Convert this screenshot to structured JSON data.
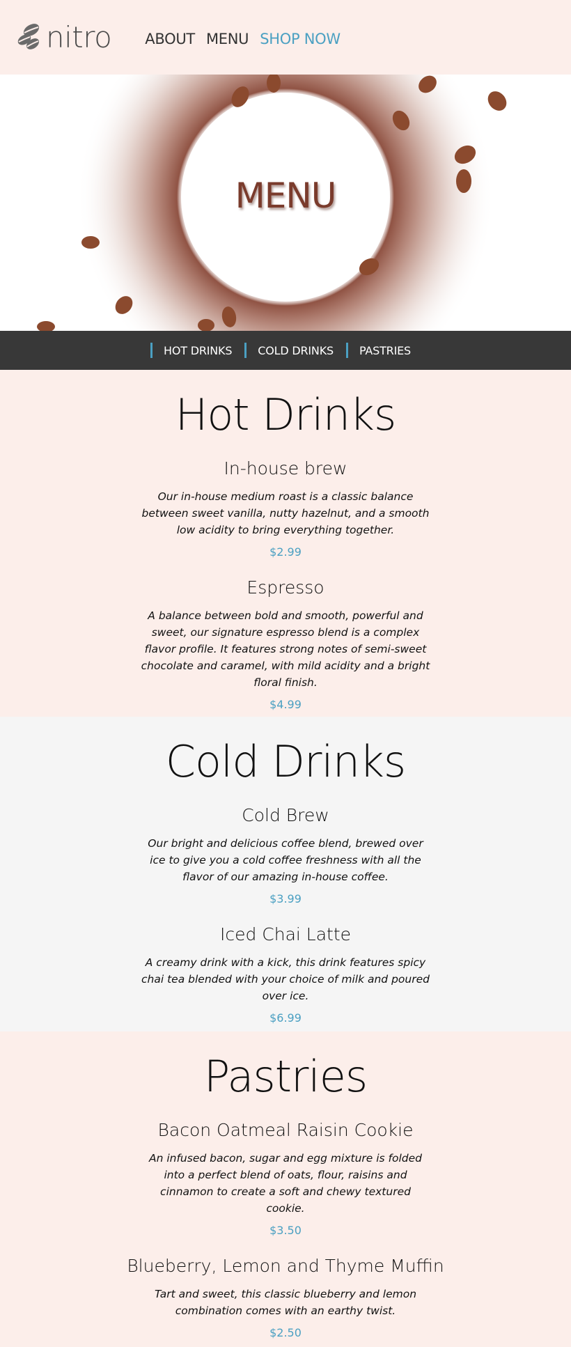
{
  "header": {
    "logo_text": "nitro",
    "nav": [
      {
        "label": "ABOUT"
      },
      {
        "label": "MENU"
      },
      {
        "label": "SHOP NOW"
      }
    ]
  },
  "hero": {
    "title": "MENU"
  },
  "subnav": [
    {
      "label": "HOT DRINKS"
    },
    {
      "label": "COLD DRINKS"
    },
    {
      "label": "PASTRIES"
    }
  ],
  "sections": [
    {
      "title": "Hot Drinks",
      "items": [
        {
          "name": "In-house brew",
          "description": "Our in-house medium roast is a classic balance between sweet vanilla, nutty hazelnut, and a smooth low acidity to bring everything together.",
          "price": "$2.99"
        },
        {
          "name": "Espresso",
          "description": "A balance between bold and smooth, powerful and sweet, our signature espresso blend is a complex flavor profile. It features strong notes of semi-sweet chocolate and caramel, with mild acidity and a bright floral finish.",
          "price": "$4.99"
        }
      ]
    },
    {
      "title": "Cold Drinks",
      "items": [
        {
          "name": "Cold Brew",
          "description": "Our bright and delicious coffee blend, brewed over ice to give you a cold coffee freshness with all the flavor of our amazing in-house coffee.",
          "price": "$3.99"
        },
        {
          "name": "Iced Chai Latte",
          "description": "A creamy drink with a kick, this drink features spicy chai tea blended with your choice of milk and poured over ice.",
          "price": "$6.99"
        }
      ]
    },
    {
      "title": "Pastries",
      "items": [
        {
          "name": "Bacon Oatmeal Raisin Cookie",
          "description": "An infused bacon, sugar and egg mixture is folded into a perfect blend of oats, flour, raisins and cinnamon to create a soft and chewy textured cookie.",
          "price": "$3.50"
        },
        {
          "name": "Blueberry, Lemon and Thyme Muffin",
          "description": "Tart and sweet, this classic blueberry and lemon combination comes with an earthy twist.",
          "price": "$2.50"
        }
      ]
    }
  ],
  "colors": {
    "accent": "#4ba0c2",
    "background": "#fceeea",
    "alt_background": "#f5f5f5",
    "subnav_background": "#383838",
    "coffee": "#7a3b2c"
  },
  "icons": {
    "logo": "coffee-beans-icon"
  }
}
